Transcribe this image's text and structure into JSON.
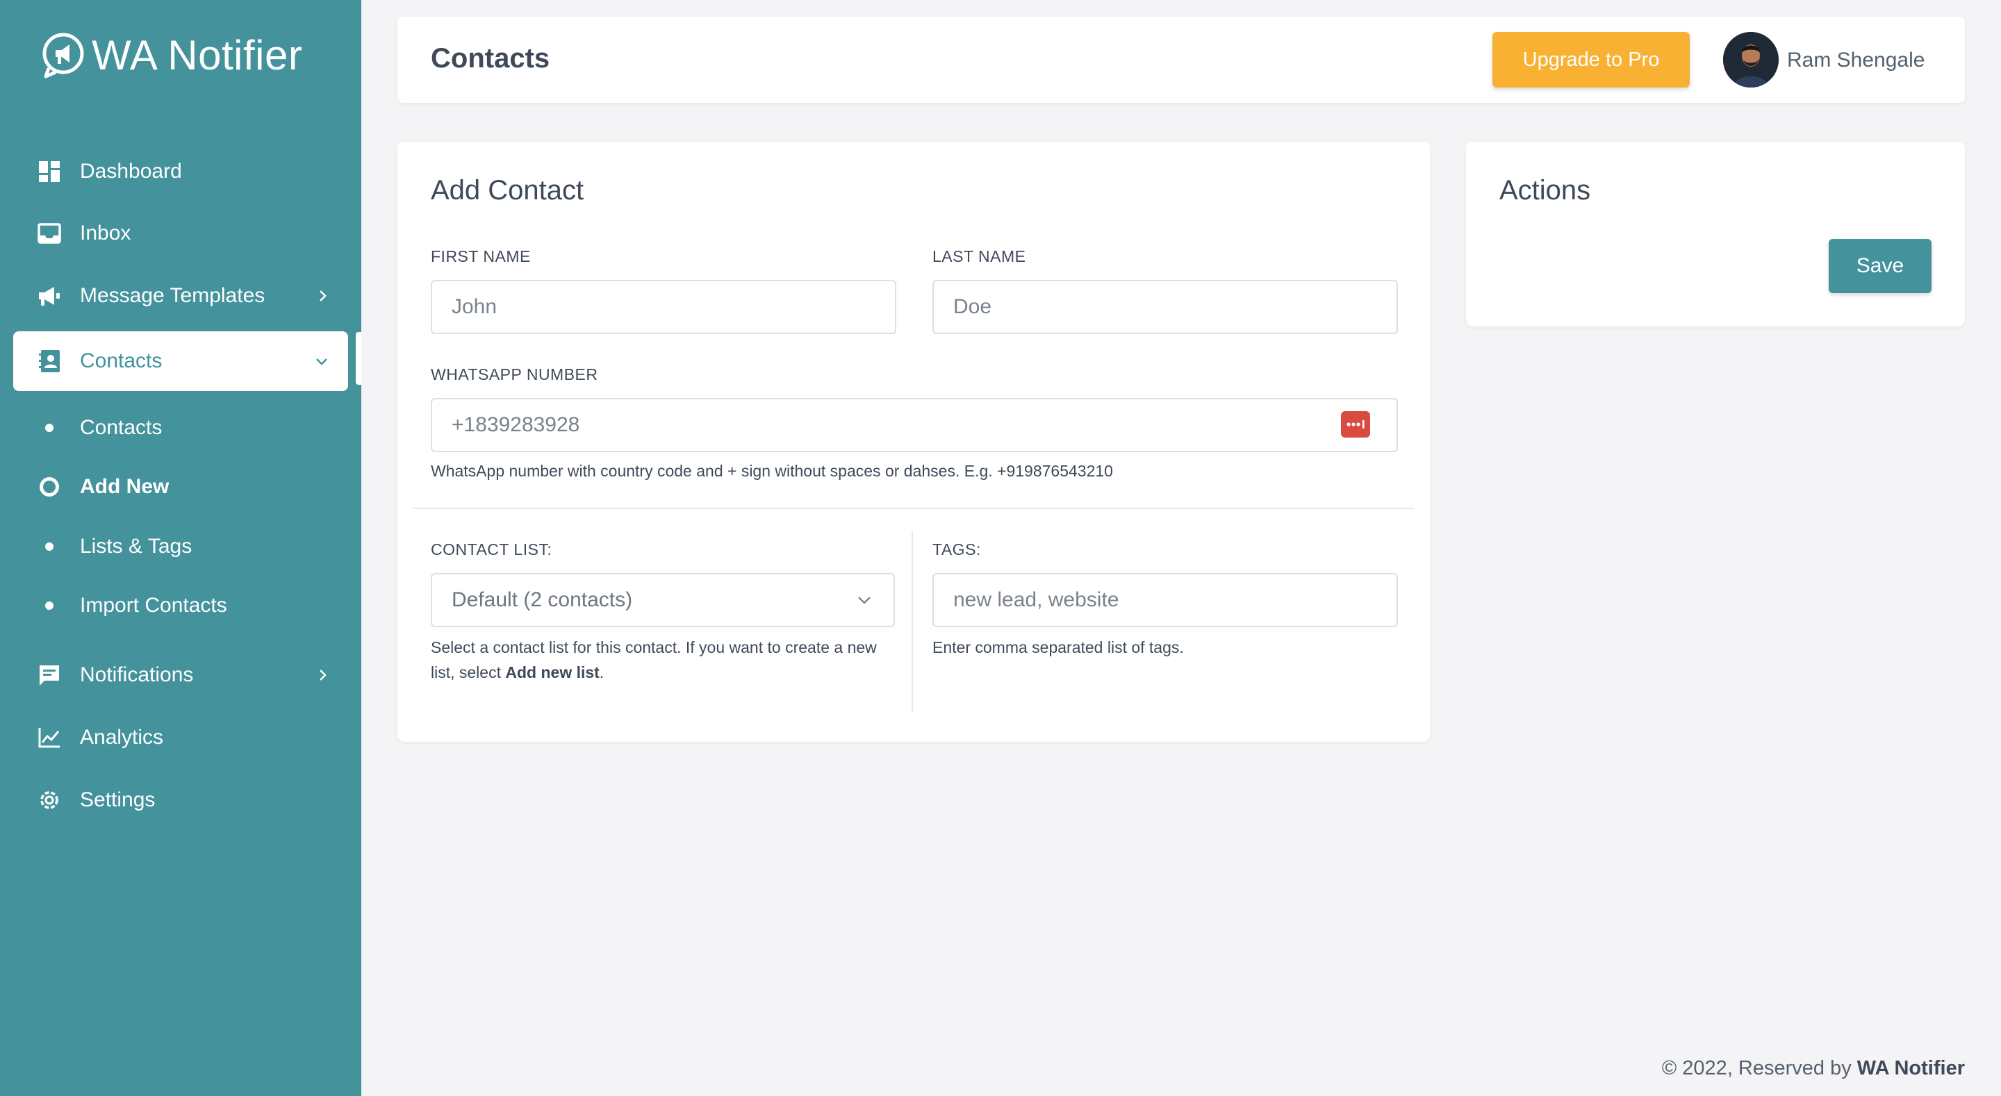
{
  "brand": {
    "name": "WA Notifier"
  },
  "sidebar": {
    "items": [
      {
        "label": "Dashboard",
        "icon": "dashboard-icon"
      },
      {
        "label": "Inbox",
        "icon": "inbox-icon"
      },
      {
        "label": "Message Templates",
        "icon": "megaphone-icon"
      },
      {
        "label": "Contacts",
        "icon": "contact-card-icon"
      },
      {
        "label": "Notifications",
        "icon": "chat-icon"
      },
      {
        "label": "Analytics",
        "icon": "chart-icon"
      },
      {
        "label": "Settings",
        "icon": "gear-icon"
      }
    ],
    "contacts_sub": [
      {
        "label": "Contacts"
      },
      {
        "label": "Add New"
      },
      {
        "label": "Lists & Tags"
      },
      {
        "label": "Import Contacts"
      }
    ]
  },
  "header": {
    "title": "Contacts",
    "upgrade_label": "Upgrade to Pro",
    "user_name": "Ram Shengale"
  },
  "add_contact": {
    "title": "Add Contact",
    "first_name_label": "FIRST NAME",
    "first_name_placeholder": "John",
    "last_name_label": "LAST NAME",
    "last_name_placeholder": "Doe",
    "whatsapp_label": "WHATSAPP NUMBER",
    "whatsapp_placeholder": "+1839283928",
    "whatsapp_help": "WhatsApp number with country code and + sign without spaces or dahses. E.g. +919876543210",
    "contact_list_label": "CONTACT LIST:",
    "contact_list_value": "Default (2 contacts)",
    "contact_list_help_pre": "Select a contact list for this contact. If you want to create a new list, select ",
    "contact_list_help_bold": "Add new list",
    "contact_list_help_post": ".",
    "tags_label": "TAGS:",
    "tags_placeholder": "new lead, website",
    "tags_help": "Enter comma separated list of tags."
  },
  "actions": {
    "title": "Actions",
    "save_label": "Save"
  },
  "footer": {
    "prefix": "© 2022, Reserved by ",
    "brand": "WA Notifier"
  },
  "colors": {
    "sidebar": "#43929c",
    "accent": "#43929c",
    "upgrade": "#f8b133",
    "password_manager": "#d94b3f"
  }
}
